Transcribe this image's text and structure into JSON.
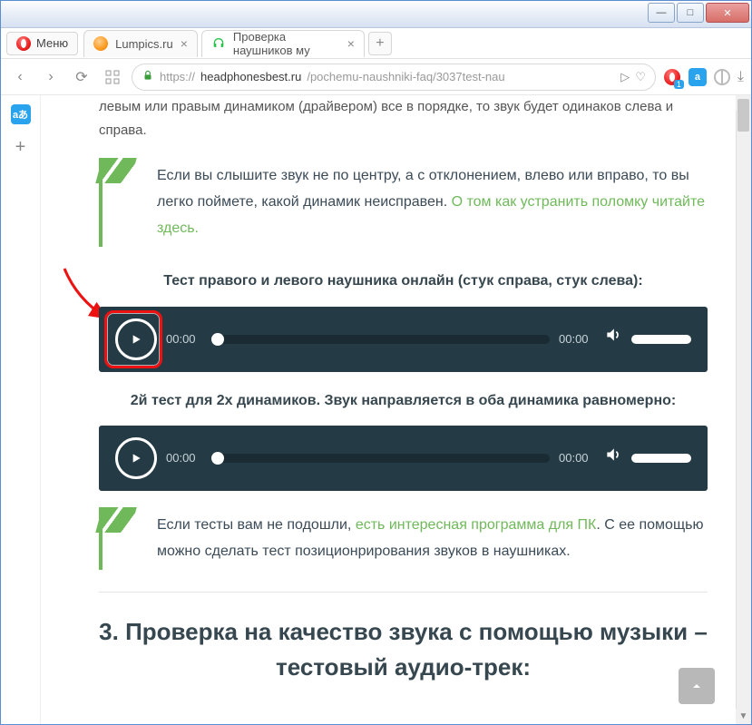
{
  "window": {
    "menu_label": "Меню"
  },
  "tabs": {
    "items": [
      {
        "title": "Lumpics.ru"
      },
      {
        "title": "Проверка наушников му"
      }
    ],
    "newtab_label": "+"
  },
  "address": {
    "scheme": "https://",
    "host": "headphonesbest.ru",
    "path": "/pochemu-naushniki-faq/3037test-nau",
    "badge_count": "1",
    "translate_label": "a"
  },
  "sidebar": {
    "translate_label": "aあ",
    "plus_label": "+"
  },
  "content": {
    "intro": "левым или правым динамиком (драйвером) все в порядке, то звук будет одинаков слева и справа.",
    "quote1_text": "Если вы слышите звук не по центру, а с отклонением, влево или вправо, то вы легко поймете, какой динамик неисправен. ",
    "quote1_link": "О том как устранить поломку читайте здесь.",
    "test1_heading": "Тест правого и левого наушника онлайн (стук справа, стук слева):",
    "test2_heading": "2й тест для 2х динамиков. Звук направляется в оба динамика равномерно:",
    "quote2_pre": "Если тесты вам не подошли, ",
    "quote2_link": "есть интересная программа для ПК",
    "quote2_post": ". С ее помощью можно сделать тест позиционрирования звуков в наушниках.",
    "section3_heading": "3. Проверка на качество звука с помощью музыки – тестовый аудио-трек:"
  },
  "player1": {
    "current": "00:00",
    "total": "00:00"
  },
  "player2": {
    "current": "00:00",
    "total": "00:00"
  }
}
